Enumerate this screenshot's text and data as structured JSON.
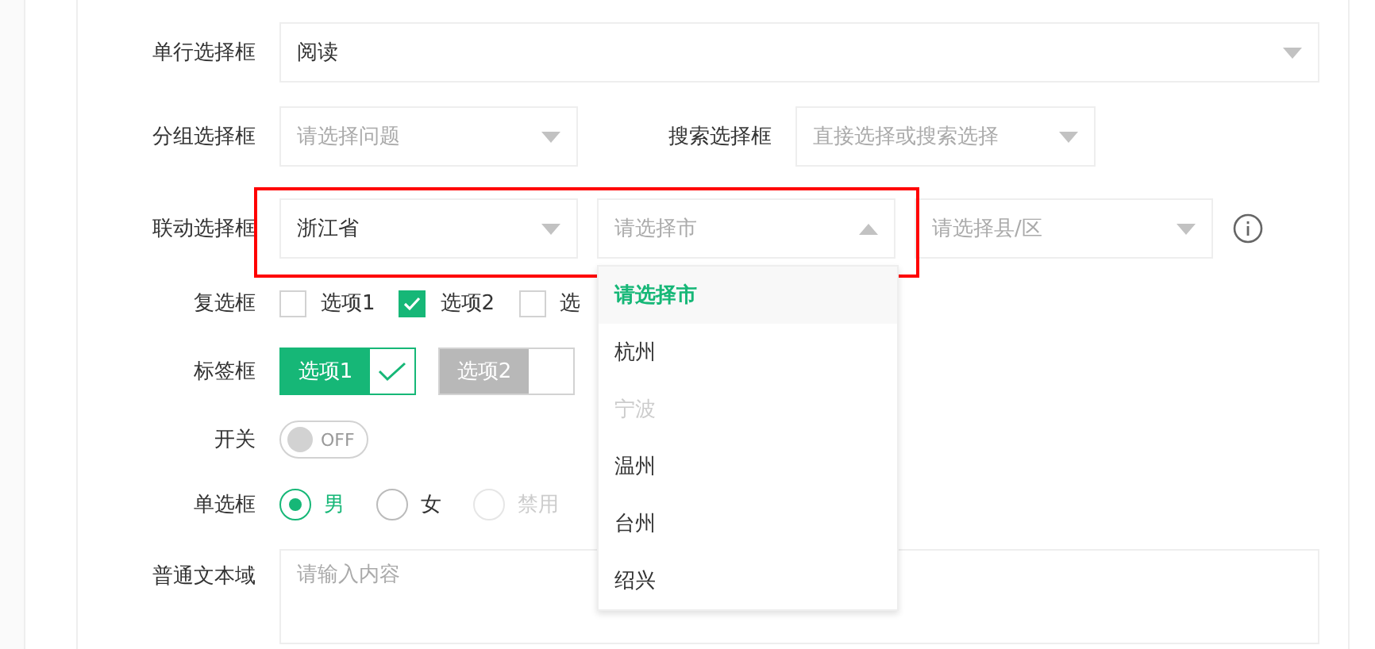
{
  "form": [
    {
      "kind": "select",
      "label": "单行选择框",
      "value": "阅读"
    },
    {
      "kind": "select_pair",
      "label": "分组选择框",
      "placeholder": "请选择问题",
      "second_label": "搜索选择框",
      "second_placeholder": "直接选择或搜索选择"
    },
    {
      "kind": "cascade",
      "label": "联动选择框",
      "highlighted": true,
      "selects": [
        {
          "value": "浙江省",
          "open": false
        },
        {
          "placeholder": "请选择市",
          "open": true,
          "options": [
            {
              "label": "请选择市",
              "selected": true,
              "disabled": false
            },
            {
              "label": "杭州",
              "selected": false,
              "disabled": false
            },
            {
              "label": "宁波",
              "selected": false,
              "disabled": true
            },
            {
              "label": "温州",
              "selected": false,
              "disabled": false
            },
            {
              "label": "台州",
              "selected": false,
              "disabled": false
            },
            {
              "label": "绍兴",
              "selected": false,
              "disabled": false
            }
          ]
        },
        {
          "placeholder": "请选择县/区",
          "open": false
        }
      ]
    },
    {
      "kind": "checkbox",
      "label": "复选框",
      "options": [
        {
          "label": "选项1",
          "checked": false
        },
        {
          "label": "选项2",
          "checked": true
        },
        {
          "label": "选",
          "checked": false
        }
      ]
    },
    {
      "kind": "tags",
      "label": "标签框",
      "options": [
        {
          "label": "选项1",
          "selected": true
        },
        {
          "label": "选项2",
          "selected": false
        }
      ]
    },
    {
      "kind": "switch",
      "label": "开关",
      "on": false,
      "text": "OFF"
    },
    {
      "kind": "radio",
      "label": "单选框",
      "options": [
        {
          "label": "男",
          "selected": true,
          "disabled": false
        },
        {
          "label": "女",
          "selected": false,
          "disabled": false
        },
        {
          "label": "禁用",
          "selected": false,
          "disabled": true
        }
      ]
    },
    {
      "kind": "textarea",
      "label": "普通文本域",
      "placeholder": "请输入内容"
    }
  ]
}
